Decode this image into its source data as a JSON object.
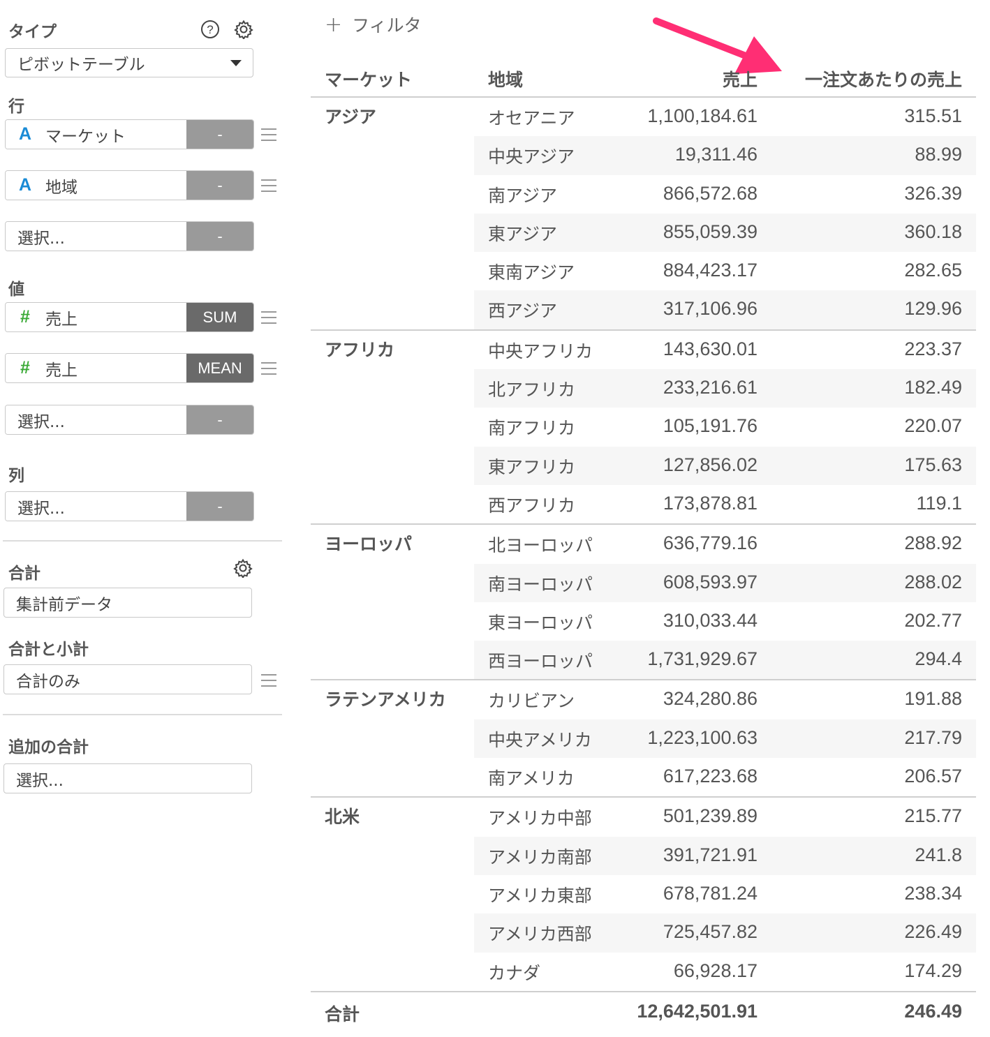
{
  "sidebar": {
    "type_label": "タイプ",
    "type_value": "ピボットテーブル",
    "rows_label": "行",
    "rows": [
      {
        "type": "A",
        "name": "マーケット",
        "agg": "-"
      },
      {
        "type": "A",
        "name": "地域",
        "agg": "-"
      }
    ],
    "rows_placeholder": {
      "name": "選択...",
      "agg": "-"
    },
    "values_label": "値",
    "values": [
      {
        "type": "#",
        "name": "売上",
        "agg": "SUM"
      },
      {
        "type": "#",
        "name": "売上",
        "agg": "MEAN"
      }
    ],
    "values_placeholder": {
      "name": "選択...",
      "agg": "-"
    },
    "columns_label": "列",
    "columns_placeholder": {
      "name": "選択...",
      "agg": "-"
    },
    "total_label": "合計",
    "total_value": "集計前データ",
    "subtotal_label": "合計と小計",
    "subtotal_value": "合計のみ",
    "extra_total_label": "追加の合計",
    "extra_total_value": "選択..."
  },
  "filter_label": "フィルタ",
  "table": {
    "headers": {
      "market": "マーケット",
      "region": "地域",
      "sales": "売上",
      "mean": "一注文あたりの売上"
    },
    "groups": [
      {
        "market": "アジア",
        "rows": [
          {
            "region": "オセアニア",
            "sales": "1,100,184.61",
            "mean": "315.51"
          },
          {
            "region": "中央アジア",
            "sales": "19,311.46",
            "mean": "88.99"
          },
          {
            "region": "南アジア",
            "sales": "866,572.68",
            "mean": "326.39"
          },
          {
            "region": "東アジア",
            "sales": "855,059.39",
            "mean": "360.18"
          },
          {
            "region": "東南アジア",
            "sales": "884,423.17",
            "mean": "282.65"
          },
          {
            "region": "西アジア",
            "sales": "317,106.96",
            "mean": "129.96"
          }
        ]
      },
      {
        "market": "アフリカ",
        "rows": [
          {
            "region": "中央アフリカ",
            "sales": "143,630.01",
            "mean": "223.37"
          },
          {
            "region": "北アフリカ",
            "sales": "233,216.61",
            "mean": "182.49"
          },
          {
            "region": "南アフリカ",
            "sales": "105,191.76",
            "mean": "220.07"
          },
          {
            "region": "東アフリカ",
            "sales": "127,856.02",
            "mean": "175.63"
          },
          {
            "region": "西アフリカ",
            "sales": "173,878.81",
            "mean": "119.1"
          }
        ]
      },
      {
        "market": "ヨーロッパ",
        "rows": [
          {
            "region": "北ヨーロッパ",
            "sales": "636,779.16",
            "mean": "288.92"
          },
          {
            "region": "南ヨーロッパ",
            "sales": "608,593.97",
            "mean": "288.02"
          },
          {
            "region": "東ヨーロッパ",
            "sales": "310,033.44",
            "mean": "202.77"
          },
          {
            "region": "西ヨーロッパ",
            "sales": "1,731,929.67",
            "mean": "294.4"
          }
        ]
      },
      {
        "market": "ラテンアメリカ",
        "rows": [
          {
            "region": "カリビアン",
            "sales": "324,280.86",
            "mean": "191.88"
          },
          {
            "region": "中央アメリカ",
            "sales": "1,223,100.63",
            "mean": "217.79"
          },
          {
            "region": "南アメリカ",
            "sales": "617,223.68",
            "mean": "206.57"
          }
        ]
      },
      {
        "market": "北米",
        "rows": [
          {
            "region": "アメリカ中部",
            "sales": "501,239.89",
            "mean": "215.77"
          },
          {
            "region": "アメリカ南部",
            "sales": "391,721.91",
            "mean": "241.8"
          },
          {
            "region": "アメリカ東部",
            "sales": "678,781.24",
            "mean": "238.34"
          },
          {
            "region": "アメリカ西部",
            "sales": "725,457.82",
            "mean": "226.49"
          },
          {
            "region": "カナダ",
            "sales": "66,928.17",
            "mean": "174.29"
          }
        ]
      }
    ],
    "total": {
      "label": "合計",
      "sales": "12,642,501.91",
      "mean": "246.49"
    }
  },
  "colors": {
    "arrow": "#ff2e74",
    "string_type": "#1a8bd6",
    "number_type": "#39a935"
  },
  "icons": {
    "help": "question-circle-icon",
    "settings": "gear-icon",
    "add": "plus-icon"
  }
}
